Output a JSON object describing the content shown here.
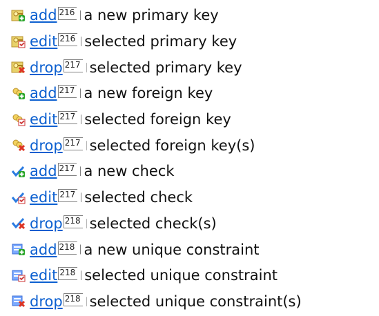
{
  "colors": {
    "link": "#0b5fd0",
    "text": "#111111",
    "pageref_border": "#808080"
  },
  "items": [
    {
      "icon": "add-primary-key-icon",
      "link": "add",
      "page": "216",
      "description": "a new primary key"
    },
    {
      "icon": "edit-primary-key-icon",
      "link": "edit",
      "page": "216",
      "description": "selected primary key"
    },
    {
      "icon": "drop-primary-key-icon",
      "link": "drop",
      "page": "217",
      "description": "selected primary key"
    },
    {
      "icon": "add-foreign-key-icon",
      "link": "add",
      "page": "217",
      "description": "a new foreign key"
    },
    {
      "icon": "edit-foreign-key-icon",
      "link": "edit",
      "page": "217",
      "description": "selected foreign key"
    },
    {
      "icon": "drop-foreign-key-icon",
      "link": "drop",
      "page": "217",
      "description": "selected foreign key(s)"
    },
    {
      "icon": "add-check-icon",
      "link": "add",
      "page": "217",
      "description": "a new check"
    },
    {
      "icon": "edit-check-icon",
      "link": "edit",
      "page": "217",
      "description": "selected check"
    },
    {
      "icon": "drop-check-icon",
      "link": "drop",
      "page": "218",
      "description": "selected check(s)"
    },
    {
      "icon": "add-unique-constraint-icon",
      "link": "add",
      "page": "218",
      "description": "a new unique constraint"
    },
    {
      "icon": "edit-unique-constraint-icon",
      "link": "edit",
      "page": "218",
      "description": "selected unique constraint"
    },
    {
      "icon": "drop-unique-constraint-icon",
      "link": "drop",
      "page": "218",
      "description": "selected unique constraint(s)"
    }
  ]
}
